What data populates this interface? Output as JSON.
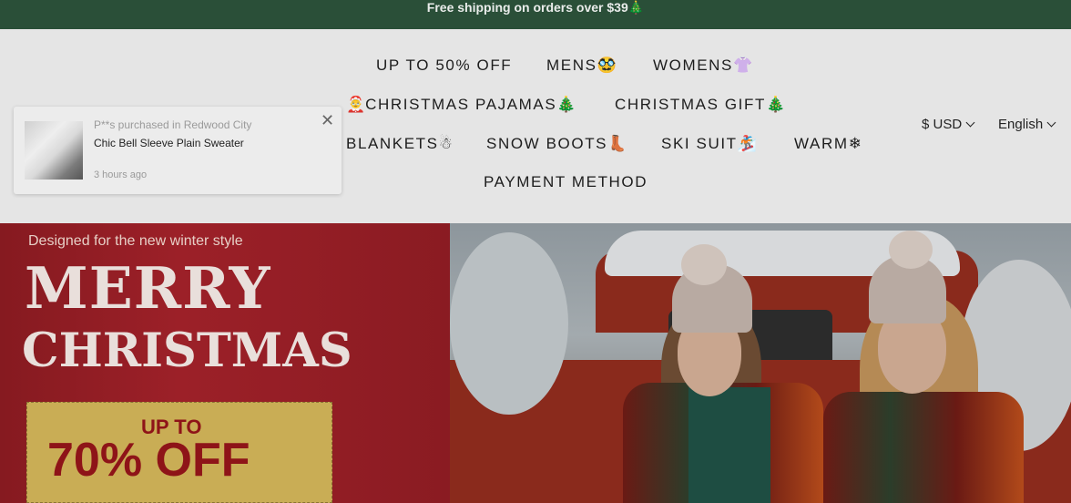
{
  "announcement": {
    "text": "Free shipping on orders over $39🎄"
  },
  "nav": {
    "items": [
      {
        "label": "UP TO 50% OFF",
        "emoji": ""
      },
      {
        "label": "MENS",
        "emoji": "🥸"
      },
      {
        "label": "WOMENS",
        "emoji": "👚"
      },
      {
        "label": "CHRISTMAS PAJAMAS",
        "emoji": "🎄",
        "prefix": "🤶"
      },
      {
        "label": "CHRISTMAS GIFT",
        "emoji": "🎄"
      },
      {
        "label": "BLANKETS",
        "emoji": "☃"
      },
      {
        "label": "SNOW BOOTS",
        "emoji": "👢"
      },
      {
        "label": "SKI SUIT",
        "emoji": "🏂"
      },
      {
        "label": "WARM",
        "emoji": "❄"
      },
      {
        "label": "PAYMENT METHOD",
        "emoji": ""
      }
    ]
  },
  "currency": {
    "label": "$ USD"
  },
  "language": {
    "label": "English"
  },
  "popup": {
    "buyer": "P**s purchased in Redwood City",
    "product": "Chic Bell Sleeve Plain Sweater",
    "time": "3 hours ago",
    "close_icon": "close-icon"
  },
  "banner": {
    "tagline": "Designed for the new winter style",
    "line1": "MERRY",
    "line2": "CHRISTMAS",
    "badge_top": "UP TO",
    "badge_main": "70% OFF"
  },
  "colors": {
    "announcement_bg": "#2a4f38",
    "header_bg": "#e5e5e5",
    "banner_red": "#9c2028",
    "badge_gold": "#c9ad55",
    "badge_text": "#8e1418"
  }
}
